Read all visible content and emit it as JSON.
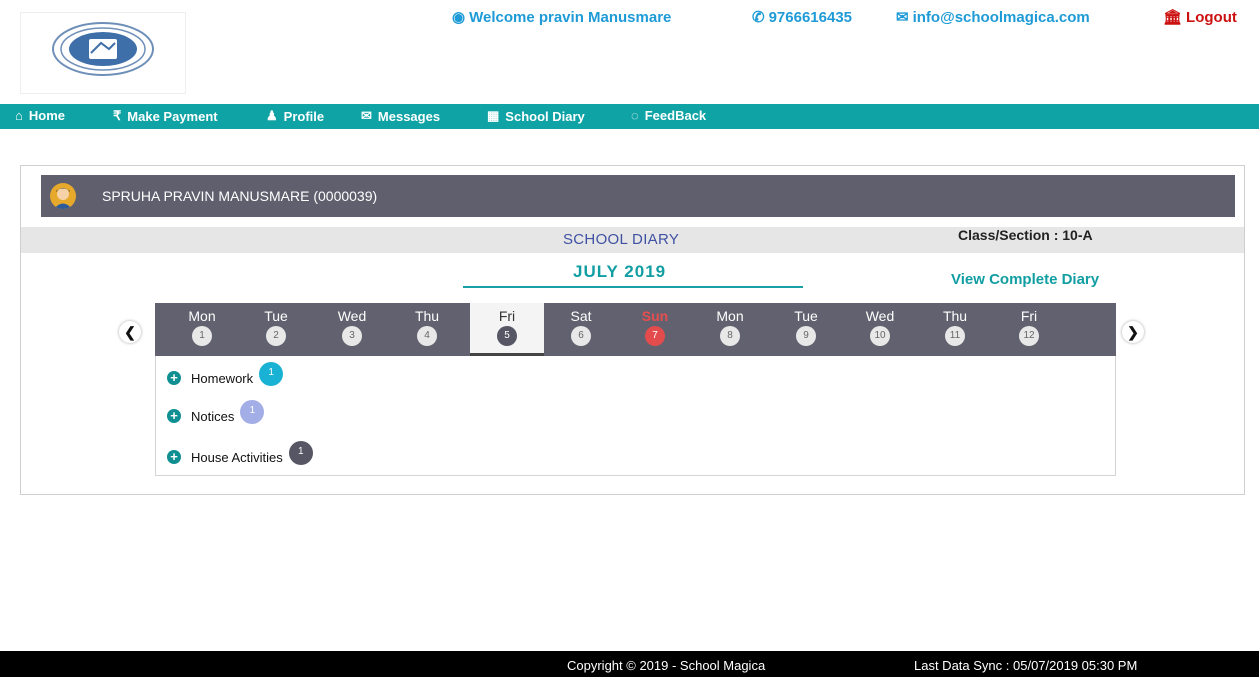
{
  "header": {
    "welcome": "Welcome pravin Manusmare",
    "phone": "9766616435",
    "email": "info@schoolmagica.com",
    "logout": "Logout"
  },
  "nav": [
    {
      "label": "Home",
      "icon": "home-icon"
    },
    {
      "label": "Make Payment",
      "icon": "rupee-icon"
    },
    {
      "label": "Profile",
      "icon": "user-icon"
    },
    {
      "label": "Messages",
      "icon": "envelope-icon"
    },
    {
      "label": "School Diary",
      "icon": "calendar-icon"
    },
    {
      "label": "FeedBack",
      "icon": "chat-icon"
    }
  ],
  "student": {
    "name": "SPRUHA PRAVIN MANUSMARE (0000039)"
  },
  "diary": {
    "title": "SCHOOL DIARY",
    "class_section": "Class/Section : 10-A",
    "month": "JULY  2019",
    "view_complete": "View Complete Diary",
    "days": [
      {
        "name": "Mon",
        "num": "1"
      },
      {
        "name": "Tue",
        "num": "2"
      },
      {
        "name": "Wed",
        "num": "3"
      },
      {
        "name": "Thu",
        "num": "4"
      },
      {
        "name": "Fri",
        "num": "5",
        "selected": true
      },
      {
        "name": "Sat",
        "num": "6"
      },
      {
        "name": "Sun",
        "num": "7",
        "sunday": true
      },
      {
        "name": "Mon",
        "num": "8"
      },
      {
        "name": "Tue",
        "num": "9"
      },
      {
        "name": "Wed",
        "num": "10"
      },
      {
        "name": "Thu",
        "num": "11"
      },
      {
        "name": "Fri",
        "num": "12"
      }
    ],
    "items": [
      {
        "label": "Homework",
        "count": "1",
        "color": "#1ab2d4"
      },
      {
        "label": "Notices",
        "count": "1",
        "color": "#a3aee6"
      },
      {
        "label": "House Activities",
        "count": "1",
        "color": "#565664"
      }
    ]
  },
  "footer": {
    "copyright": "Copyright © 2019 - School Magica",
    "last_sync": "Last Data Sync : 05/07/2019 05:30 PM"
  },
  "colors": {
    "accent": "#10a3a5",
    "header_link": "#1e9bd7",
    "logout": "#cc1111",
    "sunday": "#e24c4c",
    "student_bar": "#5f5f6e"
  }
}
